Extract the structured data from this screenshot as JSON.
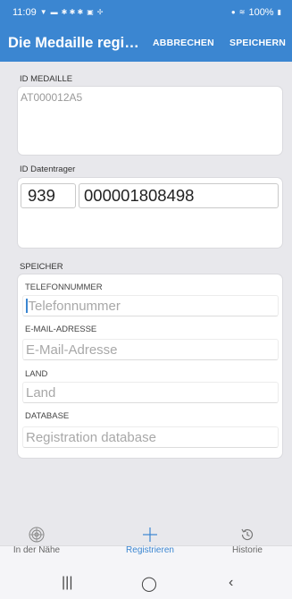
{
  "status_bar": {
    "time": "11:09",
    "battery": "100%",
    "icons": [
      "signal-icon",
      "message-icon",
      "notification-icon",
      "location-icon",
      "wifi-icon",
      "battery-icon"
    ]
  },
  "app_bar": {
    "title": "Die Medaille regi…",
    "cancel_label": "ABBRECHEN",
    "save_label": "SPEICHERN",
    "color": "#3b86d1"
  },
  "medal": {
    "label": "ID MEDAILLE",
    "value": "AT000012A5"
  },
  "carrier": {
    "label": "ID Datentrager",
    "prefix": "939",
    "number": "000001808498"
  },
  "storage": {
    "label": "SPEICHER",
    "fields": [
      {
        "label": "TELEFONNUMMER",
        "placeholder": "Telefonnummer"
      },
      {
        "label": "E-MAIL-ADRESSE",
        "placeholder": "E-Mail-Adresse"
      },
      {
        "label": "LAND",
        "placeholder": "Land"
      },
      {
        "label": "DATABASE",
        "placeholder": "Registration database"
      }
    ]
  },
  "bottom_nav": {
    "items": [
      {
        "label": "In der Nähe",
        "icon": "radar-icon"
      },
      {
        "label": "Registrieren",
        "icon": "plus-icon",
        "active": true
      },
      {
        "label": "Historie",
        "icon": "history-icon"
      }
    ]
  },
  "system_nav": {
    "recents": "|||",
    "home": "◯",
    "back": "‹"
  }
}
